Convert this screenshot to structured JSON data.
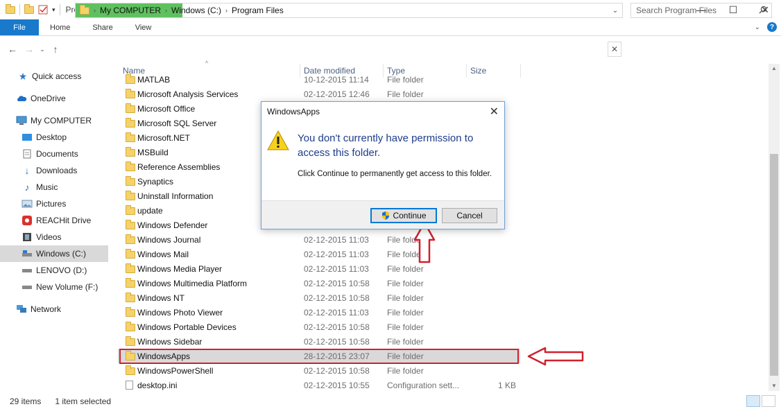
{
  "window": {
    "title": "Program Files",
    "controls": {
      "minimize": "—",
      "maximize": "☐",
      "close": "✕"
    }
  },
  "ribbon": {
    "tabs": [
      "File",
      "Home",
      "Share",
      "View"
    ],
    "help": "?"
  },
  "address": {
    "crumbs": [
      "My COMPUTER",
      "Windows (C:)",
      "Program Files"
    ],
    "search_placeholder": "Search Program Files"
  },
  "sidebar": {
    "items": [
      {
        "label": "Quick access",
        "icon": "star-icon"
      },
      {
        "label": "OneDrive",
        "icon": "cloud-icon"
      },
      {
        "label": "My COMPUTER",
        "icon": "computer-icon"
      },
      {
        "label": "Desktop",
        "icon": "desktop-icon"
      },
      {
        "label": "Documents",
        "icon": "documents-icon"
      },
      {
        "label": "Downloads",
        "icon": "download-icon"
      },
      {
        "label": "Music",
        "icon": "music-icon"
      },
      {
        "label": "Pictures",
        "icon": "pictures-icon"
      },
      {
        "label": "REACHit Drive",
        "icon": "drive-icon"
      },
      {
        "label": "Videos",
        "icon": "video-icon"
      },
      {
        "label": "Windows (C:)",
        "icon": "disk-icon"
      },
      {
        "label": "LENOVO (D:)",
        "icon": "disk-icon"
      },
      {
        "label": "New Volume (F:)",
        "icon": "disk-icon"
      },
      {
        "label": "Network",
        "icon": "network-icon"
      }
    ]
  },
  "columns": {
    "name": "Name",
    "date": "Date modified",
    "type": "Type",
    "size": "Size"
  },
  "files": [
    {
      "name": "MATLAB",
      "date": "10-12-2015 11:14",
      "type": "File folder",
      "size": ""
    },
    {
      "name": "Microsoft Analysis Services",
      "date": "02-12-2015 12:46",
      "type": "File folder",
      "size": ""
    },
    {
      "name": "Microsoft Office",
      "date": "",
      "type": "",
      "size": ""
    },
    {
      "name": "Microsoft SQL Server",
      "date": "",
      "type": "",
      "size": ""
    },
    {
      "name": "Microsoft.NET",
      "date": "",
      "type": "",
      "size": ""
    },
    {
      "name": "MSBuild",
      "date": "",
      "type": "",
      "size": ""
    },
    {
      "name": "Reference Assemblies",
      "date": "",
      "type": "",
      "size": ""
    },
    {
      "name": "Synaptics",
      "date": "",
      "type": "",
      "size": ""
    },
    {
      "name": "Uninstall Information",
      "date": "",
      "type": "",
      "size": ""
    },
    {
      "name": "update",
      "date": "",
      "type": "",
      "size": ""
    },
    {
      "name": "Windows Defender",
      "date": "",
      "type": "",
      "size": ""
    },
    {
      "name": "Windows Journal",
      "date": "02-12-2015 11:03",
      "type": "File folder",
      "size": ""
    },
    {
      "name": "Windows Mail",
      "date": "02-12-2015 11:03",
      "type": "File folder",
      "size": ""
    },
    {
      "name": "Windows Media Player",
      "date": "02-12-2015 11:03",
      "type": "File folder",
      "size": ""
    },
    {
      "name": "Windows Multimedia Platform",
      "date": "02-12-2015 10:58",
      "type": "File folder",
      "size": ""
    },
    {
      "name": "Windows NT",
      "date": "02-12-2015 10:58",
      "type": "File folder",
      "size": ""
    },
    {
      "name": "Windows Photo Viewer",
      "date": "02-12-2015 11:03",
      "type": "File folder",
      "size": ""
    },
    {
      "name": "Windows Portable Devices",
      "date": "02-12-2015 10:58",
      "type": "File folder",
      "size": ""
    },
    {
      "name": "Windows Sidebar",
      "date": "02-12-2015 10:58",
      "type": "File folder",
      "size": ""
    },
    {
      "name": "WindowsApps",
      "date": "28-12-2015 23:07",
      "type": "File folder",
      "size": "",
      "selected": true
    },
    {
      "name": "WindowsPowerShell",
      "date": "02-12-2015 10:58",
      "type": "File folder",
      "size": ""
    },
    {
      "name": "desktop.ini",
      "date": "02-12-2015 10:55",
      "type": "Configuration sett...",
      "size": "1 KB",
      "is_file": true
    }
  ],
  "status": {
    "items": "29 items",
    "selected": "1 item selected"
  },
  "dialog": {
    "title": "WindowsApps",
    "close": "✕",
    "main": "You don't currently have permission to access this folder.",
    "sub": "Click Continue to permanently get access to this folder.",
    "continue_label": "Continue",
    "cancel_label": "Cancel"
  },
  "colors": {
    "accent": "#1979ca",
    "annotation": "#d0202d",
    "address_highlight": "#5fc05f"
  }
}
